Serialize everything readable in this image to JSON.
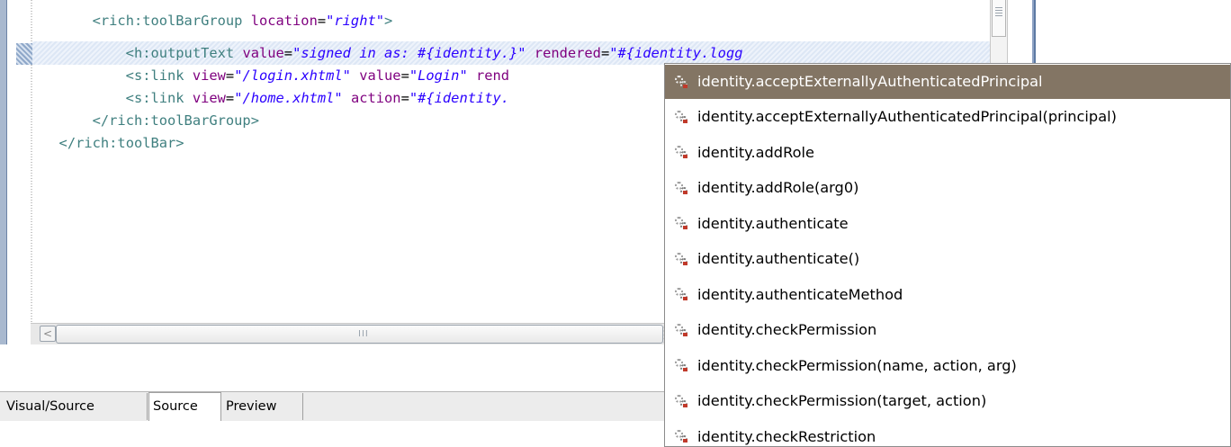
{
  "editor": {
    "lines": [
      {
        "indent": "      ",
        "parts": [
          {
            "cls": "tag",
            "t": "<"
          },
          {
            "cls": "tagname",
            "t": "rich:toolBarGroup"
          },
          {
            "cls": "punct",
            "t": " "
          },
          {
            "cls": "attr",
            "t": "location"
          },
          {
            "cls": "eq",
            "t": "="
          },
          {
            "cls": "val",
            "t": "\"right\""
          },
          {
            "cls": "tag",
            "t": ">"
          }
        ]
      },
      {
        "indent": "          ",
        "parts": [
          {
            "cls": "tag",
            "t": "<"
          },
          {
            "cls": "tagname",
            "t": "h:outputText"
          },
          {
            "cls": "punct",
            "t": " "
          },
          {
            "cls": "attr",
            "t": "value"
          },
          {
            "cls": "eq",
            "t": "="
          },
          {
            "cls": "val",
            "t": "\"signed in as: #{identity.}\""
          },
          {
            "cls": "punct",
            "t": " "
          },
          {
            "cls": "attr",
            "t": "rendered"
          },
          {
            "cls": "eq",
            "t": "="
          },
          {
            "cls": "val",
            "t": "\"#{identity.logg"
          }
        ]
      },
      {
        "indent": "          ",
        "parts": [
          {
            "cls": "tag",
            "t": "<"
          },
          {
            "cls": "tagname",
            "t": "s:link"
          },
          {
            "cls": "punct",
            "t": " "
          },
          {
            "cls": "attr",
            "t": "view"
          },
          {
            "cls": "eq",
            "t": "="
          },
          {
            "cls": "val",
            "t": "\"/login.xhtml\""
          },
          {
            "cls": "punct",
            "t": " "
          },
          {
            "cls": "attr",
            "t": "value"
          },
          {
            "cls": "eq",
            "t": "="
          },
          {
            "cls": "val",
            "t": "\"Login\""
          },
          {
            "cls": "punct",
            "t": " "
          },
          {
            "cls": "attr",
            "t": "rend"
          }
        ]
      },
      {
        "indent": "          ",
        "parts": [
          {
            "cls": "tag",
            "t": "<"
          },
          {
            "cls": "tagname",
            "t": "s:link"
          },
          {
            "cls": "punct",
            "t": " "
          },
          {
            "cls": "attr",
            "t": "view"
          },
          {
            "cls": "eq",
            "t": "="
          },
          {
            "cls": "val",
            "t": "\"/home.xhtml\""
          },
          {
            "cls": "punct",
            "t": " "
          },
          {
            "cls": "attr",
            "t": "action"
          },
          {
            "cls": "eq",
            "t": "="
          },
          {
            "cls": "val",
            "t": "\"#{identity."
          }
        ]
      },
      {
        "indent": "      ",
        "parts": [
          {
            "cls": "tag",
            "t": "</"
          },
          {
            "cls": "tagname",
            "t": "rich:toolBarGroup"
          },
          {
            "cls": "tag",
            "t": ">"
          }
        ]
      },
      {
        "indent": "  ",
        "parts": [
          {
            "cls": "tag",
            "t": "</"
          },
          {
            "cls": "tagname",
            "t": "rich:toolBar"
          },
          {
            "cls": "tag",
            "t": ">"
          }
        ]
      }
    ],
    "hscroll_left_arrow": "<",
    "hscroll_grip": "III"
  },
  "tabs": {
    "visual_source": "Visual/Source",
    "source": "Source",
    "preview": "Preview"
  },
  "content_assist": {
    "icon": "el-property-icon",
    "selected_index": 0,
    "items": [
      "identity.acceptExternallyAuthenticatedPrincipal",
      "identity.acceptExternallyAuthenticatedPrincipal(principal)",
      "identity.addRole",
      "identity.addRole(arg0)",
      "identity.authenticate",
      "identity.authenticate()",
      "identity.authenticateMethod",
      "identity.checkPermission",
      "identity.checkPermission(name, action, arg)",
      "identity.checkPermission(target, action)",
      "identity.checkRestriction"
    ]
  },
  "colors": {
    "selection": "#837564",
    "tag": "#3f7f7f",
    "attribute": "#7f007f",
    "value": "#2a00ff"
  }
}
